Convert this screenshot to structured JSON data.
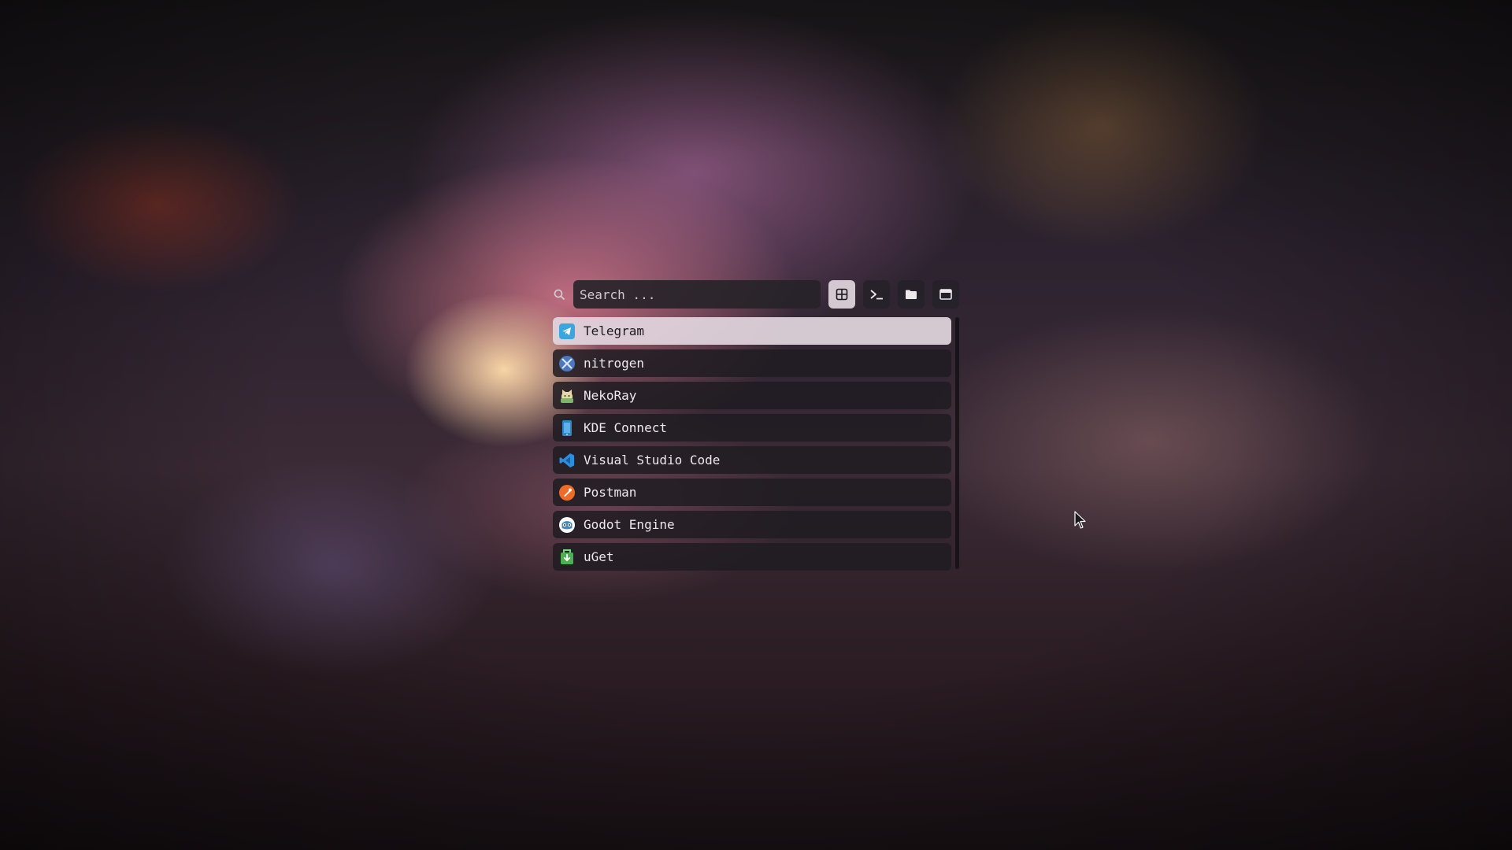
{
  "search": {
    "placeholder": "Search ..."
  },
  "modes": [
    {
      "name": "applications",
      "icon": "grid-icon",
      "active": true
    },
    {
      "name": "terminal",
      "icon": "terminal-icon",
      "active": false
    },
    {
      "name": "files",
      "icon": "folder-icon",
      "active": false
    },
    {
      "name": "windows",
      "icon": "window-icon",
      "active": false
    }
  ],
  "apps": [
    {
      "label": "Telegram",
      "icon": "telegram-icon",
      "selected": true
    },
    {
      "label": "nitrogen",
      "icon": "nitrogen-icon"
    },
    {
      "label": "NekoRay",
      "icon": "nekoray-icon"
    },
    {
      "label": "KDE Connect",
      "icon": "kde-connect-icon"
    },
    {
      "label": "Visual Studio Code",
      "icon": "vscode-icon"
    },
    {
      "label": "Postman",
      "icon": "postman-icon"
    },
    {
      "label": "Godot Engine",
      "icon": "godot-icon"
    },
    {
      "label": "uGet",
      "icon": "uget-icon"
    }
  ],
  "colors": {
    "selected_bg": "#e2d6de",
    "item_bg": "#201c22",
    "text": "#ece8ec"
  }
}
